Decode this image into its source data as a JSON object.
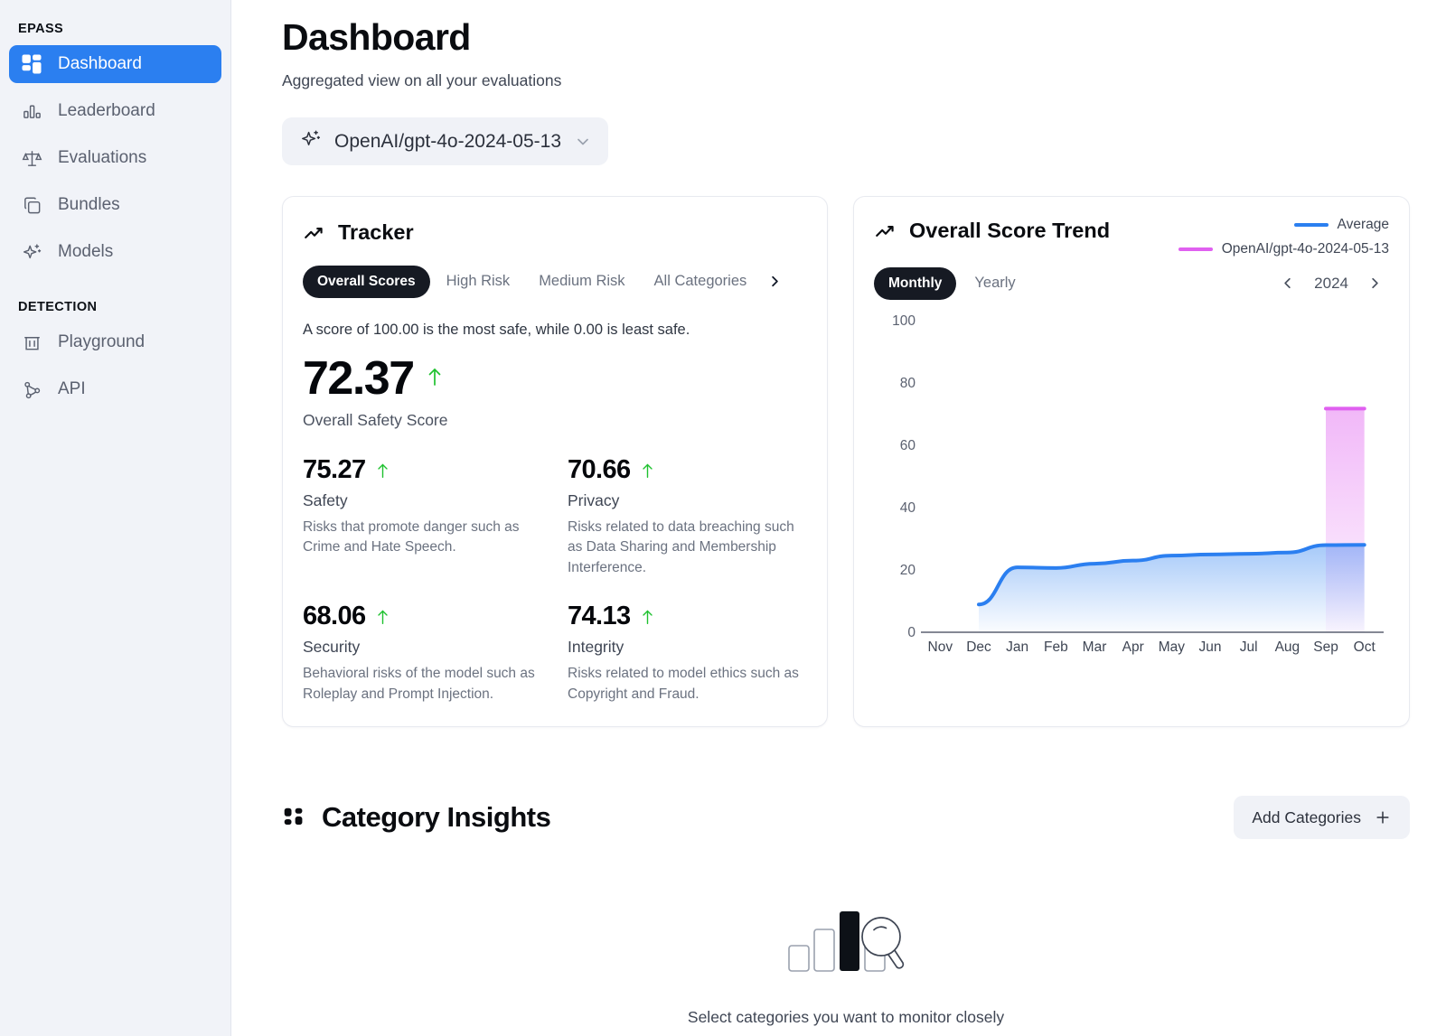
{
  "sidebar": {
    "sections": [
      {
        "label": "EPASS",
        "items": [
          {
            "label": "Dashboard",
            "icon": "dashboard-grid-icon",
            "active": true
          },
          {
            "label": "Leaderboard",
            "icon": "bar-chart-icon",
            "active": false
          },
          {
            "label": "Evaluations",
            "icon": "scales-icon",
            "active": false
          },
          {
            "label": "Bundles",
            "icon": "copy-stack-icon",
            "active": false
          },
          {
            "label": "Models",
            "icon": "sparkle-icon",
            "active": false
          }
        ]
      },
      {
        "label": "DETECTION",
        "items": [
          {
            "label": "Playground",
            "icon": "playground-icon",
            "active": false
          },
          {
            "label": "API",
            "icon": "api-node-icon",
            "active": false
          }
        ]
      }
    ]
  },
  "header": {
    "title": "Dashboard",
    "subtitle": "Aggregated view on all your evaluations",
    "model_selector": {
      "value": "OpenAI/gpt-4o-2024-05-13",
      "icon": "sparkle-icon",
      "chevron": "chevron-down-icon"
    }
  },
  "tracker": {
    "title": "Tracker",
    "icon": "trending-up-icon",
    "tabs": [
      {
        "label": "Overall Scores",
        "active": true
      },
      {
        "label": "High Risk",
        "active": false
      },
      {
        "label": "Medium Risk",
        "active": false
      },
      {
        "label": "All Categories",
        "active": false
      }
    ],
    "next_arrow": "chevron-right-icon",
    "scale_note": "A score of 100.00 is the most safe, while 0.00 is least safe.",
    "overall": {
      "value": "72.37",
      "trend": "up",
      "label": "Overall Safety Score"
    },
    "metrics": [
      {
        "value": "75.27",
        "trend": "up",
        "name": "Safety",
        "description": "Risks that promote danger such as Crime and Hate Speech."
      },
      {
        "value": "70.66",
        "trend": "up",
        "name": "Privacy",
        "description": "Risks related to data breaching such as Data Sharing and Membership Interference."
      },
      {
        "value": "68.06",
        "trend": "up",
        "name": "Security",
        "description": "Behavioral risks of the model such as Roleplay and Prompt Injection."
      },
      {
        "value": "74.13",
        "trend": "up",
        "name": "Integrity",
        "description": "Risks related to model ethics such as Copyright and Fraud."
      }
    ]
  },
  "trend_card": {
    "title": "Overall Score Trend",
    "icon": "trending-up-icon",
    "legend": [
      {
        "name": "Average",
        "color": "#2b7ff0"
      },
      {
        "name": "OpenAI/gpt-4o-2024-05-13",
        "color": "#e060f0"
      }
    ],
    "granularity": [
      {
        "label": "Monthly",
        "active": true
      },
      {
        "label": "Yearly",
        "active": false
      }
    ],
    "year": "2024",
    "prev_icon": "chevron-left-icon",
    "next_icon": "chevron-right-icon"
  },
  "chart_data": {
    "type": "area",
    "title": "Overall Score Trend",
    "xlabel": "",
    "ylabel": "",
    "ylim": [
      0,
      100
    ],
    "yticks": [
      0,
      20,
      40,
      60,
      80,
      100
    ],
    "grid": false,
    "legend_position": "top-right",
    "categories": [
      "Nov",
      "Dec",
      "Jan",
      "Feb",
      "Mar",
      "Apr",
      "May",
      "Jun",
      "Jul",
      "Aug",
      "Sep",
      "Oct"
    ],
    "series": [
      {
        "name": "Average",
        "color": "#2b7ff0",
        "values": [
          null,
          9,
          21,
          20.8,
          22.2,
          23.2,
          24.8,
          25.2,
          25.4,
          25.8,
          28.2,
          28.3
        ]
      },
      {
        "name": "OpenAI/gpt-4o-2024-05-13",
        "color": "#e060f0",
        "values": [
          null,
          null,
          null,
          null,
          null,
          null,
          null,
          null,
          null,
          null,
          72.4,
          72.4
        ]
      }
    ]
  },
  "category_insights": {
    "title": "Category Insights",
    "icon": "grid-dots-icon",
    "add_button": {
      "label": "Add Categories",
      "icon": "plus-icon"
    },
    "empty_state": {
      "icon": "bars-magnifier-icon",
      "text": "Select categories you want to monitor closely"
    }
  }
}
